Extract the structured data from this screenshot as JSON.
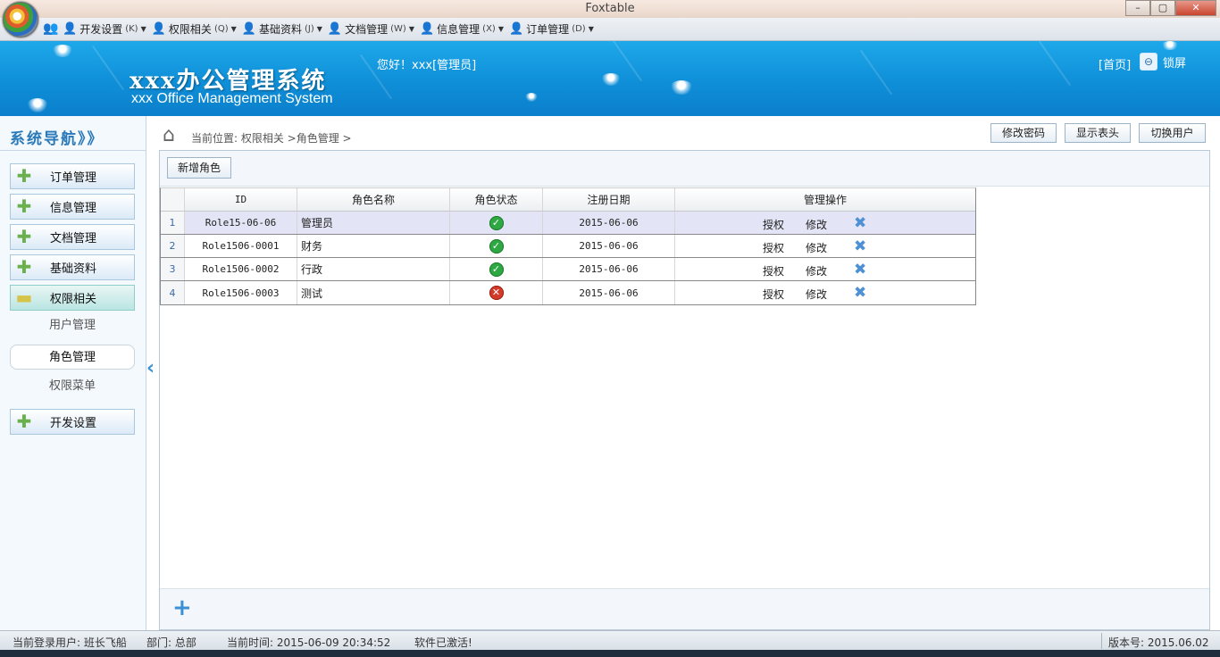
{
  "window": {
    "title": "Foxtable",
    "minimize": "–",
    "maximize": "▢",
    "close": "✕"
  },
  "menu": [
    {
      "label": "开发设置",
      "key": "(K)"
    },
    {
      "label": "权限相关",
      "key": "(Q)"
    },
    {
      "label": "基础资料",
      "key": "(J)"
    },
    {
      "label": "文档管理",
      "key": "(W)"
    },
    {
      "label": "信息管理",
      "key": "(X)"
    },
    {
      "label": "订单管理",
      "key": "(D)"
    }
  ],
  "header": {
    "system_title": "xxx办公管理系统",
    "system_subtitle": "xxx Office Management System",
    "greeting": "您好！xxx[管理员]",
    "home_link": "[首页]",
    "lock_label": "锁屏"
  },
  "nav": {
    "title": "系统导航》》",
    "items": [
      {
        "label": "订单管理"
      },
      {
        "label": "信息管理"
      },
      {
        "label": "文档管理"
      },
      {
        "label": "基础资料"
      },
      {
        "label": "权限相关"
      }
    ],
    "sub_items": [
      {
        "label": "用户管理"
      },
      {
        "label": "角色管理"
      },
      {
        "label": "权限菜单"
      }
    ],
    "last_item": {
      "label": "开发设置"
    }
  },
  "breadcrumb": {
    "text": "当前位置: 权限相关 >角色管理 >"
  },
  "top_buttons": {
    "change_password": "修改密码",
    "show_header": "显示表头",
    "switch_user": "切换用户"
  },
  "toolbar": {
    "add_role": "新增角色"
  },
  "table": {
    "columns": {
      "id": "ID",
      "name": "角色名称",
      "status": "角色状态",
      "date": "注册日期",
      "ops": "管理操作"
    },
    "op_labels": {
      "authorize": "授权",
      "edit": "修改"
    },
    "rows": [
      {
        "num": "1",
        "id": "Role15-06-06",
        "name": "管理员",
        "status": "active",
        "date": "2015-06-06"
      },
      {
        "num": "2",
        "id": "Role1506-0001",
        "name": "财务",
        "status": "active",
        "date": "2015-06-06"
      },
      {
        "num": "3",
        "id": "Role1506-0002",
        "name": "行政",
        "status": "active",
        "date": "2015-06-06"
      },
      {
        "num": "4",
        "id": "Role1506-0003",
        "name": "测试",
        "status": "disabled",
        "date": "2015-06-06"
      }
    ]
  },
  "status_bar": {
    "login_user": "当前登录用户: 班长飞船",
    "department": "部门: 总部",
    "current_time": "当前时间: 2015-06-09 20:34:52",
    "activation": "软件已激活!",
    "version": "版本号: 2015.06.02"
  },
  "colors": {
    "banner": "#0f8fd8",
    "accent": "#3b8fd4",
    "status_ok": "#2ea842",
    "status_disabled": "#d23a2a"
  }
}
